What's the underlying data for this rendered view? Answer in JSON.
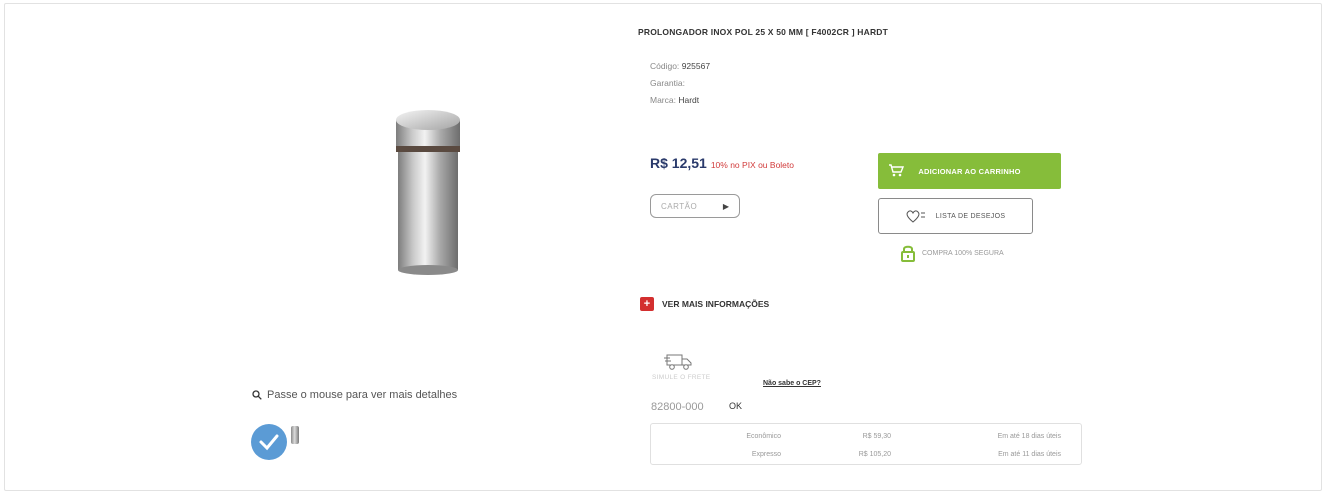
{
  "product": {
    "title": "PROLONGADOR INOX POL 25 X 50 MM [ F4002CR ] HARDT",
    "code_label": "Código:",
    "code_value": "925567",
    "warranty_label": "Garantia:",
    "brand_label": "Marca:",
    "brand_value": "Hardt"
  },
  "pricing": {
    "price": "R$ 12,51",
    "discount_note": "10% no PIX ou Boleto",
    "card_label": "CARTÃO"
  },
  "actions": {
    "add_to_cart": "ADICIONAR AO CARRINHO",
    "wishlist": "LISTA DE DESEJOS",
    "secure_purchase": "COMPRA 100% SEGURA",
    "more_info": "VER MAIS INFORMAÇÕES"
  },
  "gallery": {
    "zoom_hint": "Passe o mouse para ver mais detalhes"
  },
  "shipping": {
    "label": "SIMULE O FRETE",
    "cep_help": "Não sabe o CEP?",
    "cep_value": "82800-000",
    "ok_label": "OK",
    "options": [
      {
        "name": "Econômico",
        "price": "R$ 59,30",
        "eta": "Em até 18 dias úteis"
      },
      {
        "name": "Expresso",
        "price": "R$ 105,20",
        "eta": "Em até 11 dias úteis"
      }
    ]
  },
  "colors": {
    "cart_green": "#86bd3a",
    "price_navy": "#2a3a6b",
    "discount_red": "#d13b3b",
    "info_red": "#d32f2f",
    "thumb_blue": "#5b9bd5"
  }
}
